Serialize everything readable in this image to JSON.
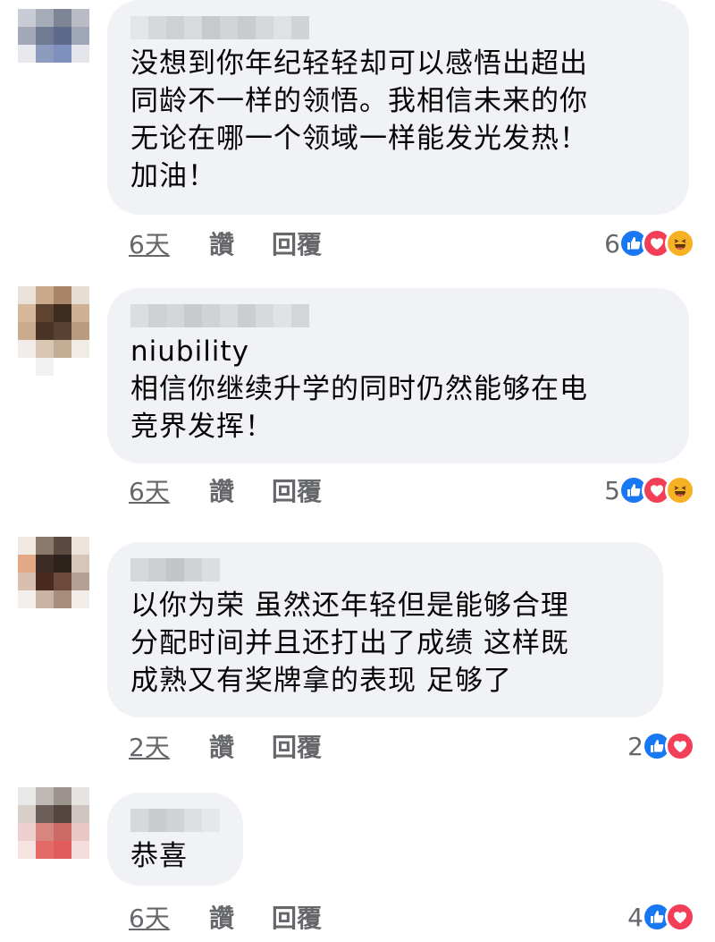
{
  "colors": {
    "bubble": "#f0f2f5",
    "meta_text": "#65676b",
    "like_blue": "#1877f2",
    "love_red": "#f33e58",
    "haha_yellow": "#f7b125"
  },
  "comments": [
    {
      "text": "没想到你年纪轻轻却可以感悟出超出\n同龄不一样的领悟。我相信未来的你\n无论在哪一个领域一样能发光发热！\n加油！",
      "time": "6天",
      "like_label": "讚",
      "reply_label": "回覆",
      "reaction_count": "6",
      "reactions": [
        "like-icon",
        "love-icon",
        "haha-icon"
      ]
    },
    {
      "text": "niubility\n相信你继续升学的同时仍然能够在电\n竞界发挥！",
      "time": "6天",
      "like_label": "讚",
      "reply_label": "回覆",
      "reaction_count": "5",
      "reactions": [
        "like-icon",
        "love-icon",
        "haha-icon"
      ]
    },
    {
      "text": "以你为荣 虽然还年轻但是能够合理\n分配时间并且还打出了成绩 这样既\n成熟又有奖牌拿的表现 足够了",
      "time": "2天",
      "like_label": "讚",
      "reply_label": "回覆",
      "reaction_count": "2",
      "reactions": [
        "like-icon",
        "love-icon"
      ]
    },
    {
      "text": "恭喜",
      "time": "6天",
      "like_label": "讚",
      "reply_label": "回覆",
      "reaction_count": "4",
      "reactions": [
        "like-icon",
        "love-icon"
      ]
    }
  ]
}
